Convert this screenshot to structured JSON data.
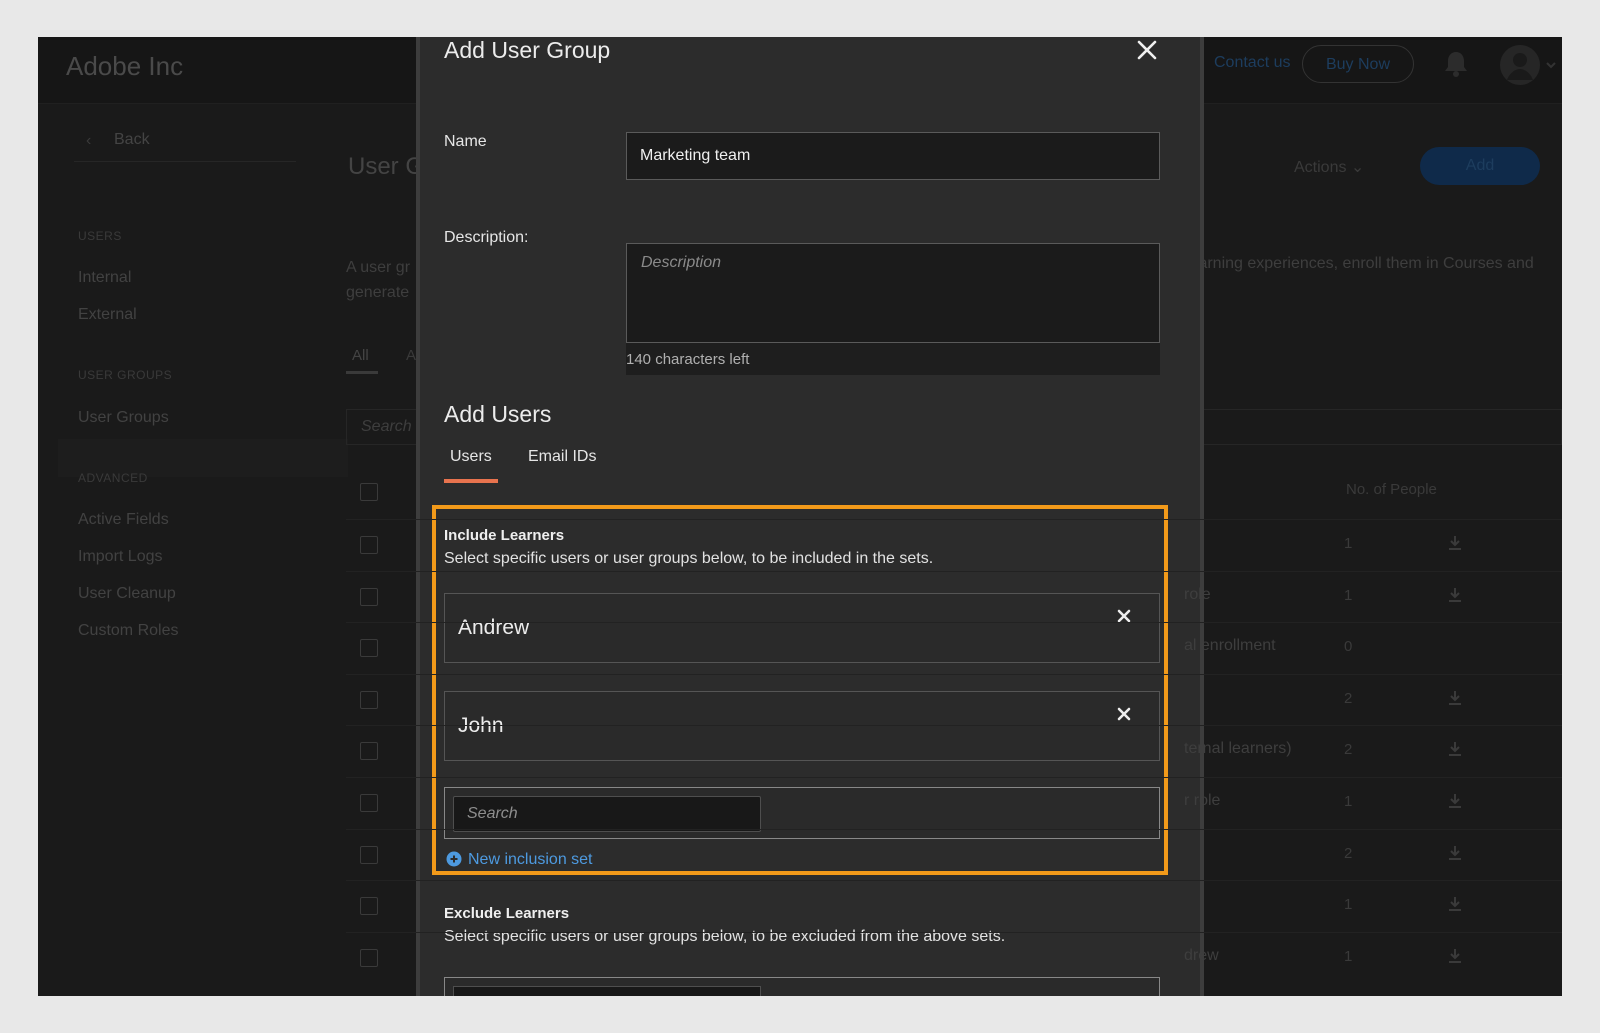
{
  "app": {
    "org_name": "Adobe Inc",
    "header": {
      "contact_link": "Contact us",
      "buy_now": "Buy Now"
    },
    "sidebar": {
      "back": "Back",
      "sections": [
        {
          "title": "USERS",
          "items": [
            "Internal",
            "External"
          ]
        },
        {
          "title": "USER GROUPS",
          "items": [
            "User Groups"
          ]
        },
        {
          "title": "ADVANCED",
          "items": [
            "Active Fields",
            "Import Logs",
            "User Cleanup",
            "Custom Roles"
          ]
        }
      ]
    },
    "main": {
      "title": "User G",
      "desc_left_1": "A user gr",
      "desc_left_2": "generate",
      "desc_right": "learning experiences, enroll them in Courses and",
      "tabs": [
        "All",
        "A"
      ],
      "search_placeholder": "Search",
      "actions": "Actions",
      "add": "Add",
      "column_people": "No. of People",
      "rows": [
        {
          "text": "",
          "count": "1",
          "download": true
        },
        {
          "text": "role",
          "count": "1",
          "download": true
        },
        {
          "text": "al enrollment",
          "count": "0",
          "download": false
        },
        {
          "text": "",
          "count": "2",
          "download": true
        },
        {
          "text": "ternal learners)",
          "count": "2",
          "download": true
        },
        {
          "text": "r role",
          "count": "1",
          "download": true
        },
        {
          "text": "",
          "count": "2",
          "download": true
        },
        {
          "text": "",
          "count": "1",
          "download": true
        },
        {
          "text": "drew",
          "count": "1",
          "download": true
        }
      ]
    }
  },
  "modal": {
    "title": "Add User Group",
    "name_label": "Name",
    "name_value": "Marketing team",
    "description_label": "Description:",
    "description_placeholder": "Description",
    "chars_left": "140 characters left",
    "add_users_heading": "Add Users",
    "tabs": [
      {
        "label": "Users",
        "active": true
      },
      {
        "label": "Email IDs",
        "active": false
      }
    ],
    "include": {
      "title": "Include Learners",
      "description": "Select specific users or user groups below, to be included in the sets.",
      "selected": [
        "Andrew",
        "John"
      ],
      "search_placeholder": "Search",
      "new_set_label": "New inclusion set"
    },
    "exclude": {
      "title": "Exclude Learners",
      "description": "Select specific users or user groups below, to be excluded from the above sets."
    },
    "colors": {
      "highlight": "#f29a1a",
      "tab_underline": "#e8734e",
      "link": "#4d9ae0"
    },
    "icons": {
      "close": "close-icon",
      "remove": "remove-icon",
      "add": "plus-circle-icon"
    }
  }
}
